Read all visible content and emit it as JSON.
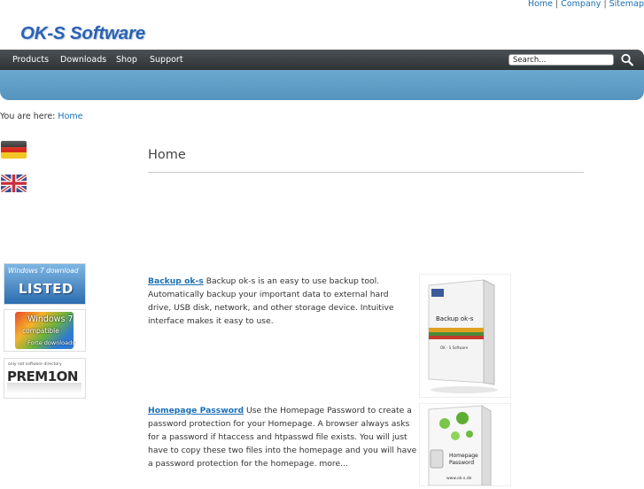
{
  "top_links": [
    "Home",
    "Company",
    "Sitemap"
  ],
  "logo": "OK-S Software",
  "nav": [
    "Products",
    "Downloads",
    "Shop",
    "Support"
  ],
  "search": {
    "value": "Search..."
  },
  "breadcrumb": {
    "prefix": "You are here:",
    "link": "Home"
  },
  "page_title": "Home",
  "badges": {
    "listed": {
      "top": "Windows 7 download",
      "main": "LISTED"
    },
    "compat": {
      "top": "Windows 7",
      "main": "compatible",
      "sub": "Forte downloads"
    },
    "prem": {
      "top": "only not software directory",
      "main": "PREM1ON"
    }
  },
  "products": [
    {
      "link": "Backup ok-s",
      "text": "Backup ok-s is an easy to use backup tool. Automatically backup your important data to external hard drive, USB disk, network, and other storage device. Intuitive interface makes it easy to use.",
      "box_label": "Backup ok-s",
      "box_maker": "OK - S Software"
    },
    {
      "link": "Homepage Password",
      "text": "Use the Homepage Password to create a password protection for your Homepage. A browser always asks for a password if htaccess and htpasswd file exists. You will just have to copy these two files into the homepage and you will have a password protection for the homepage. more...",
      "box_label_1": "Homepage",
      "box_label_2": "Password",
      "box_url": "www.ok-s.de"
    }
  ],
  "colors": {
    "link": "#1a6fb5",
    "navbar": "#3a3f43",
    "bluebar": "#5d9bc4",
    "logo": "#2a62b4"
  }
}
